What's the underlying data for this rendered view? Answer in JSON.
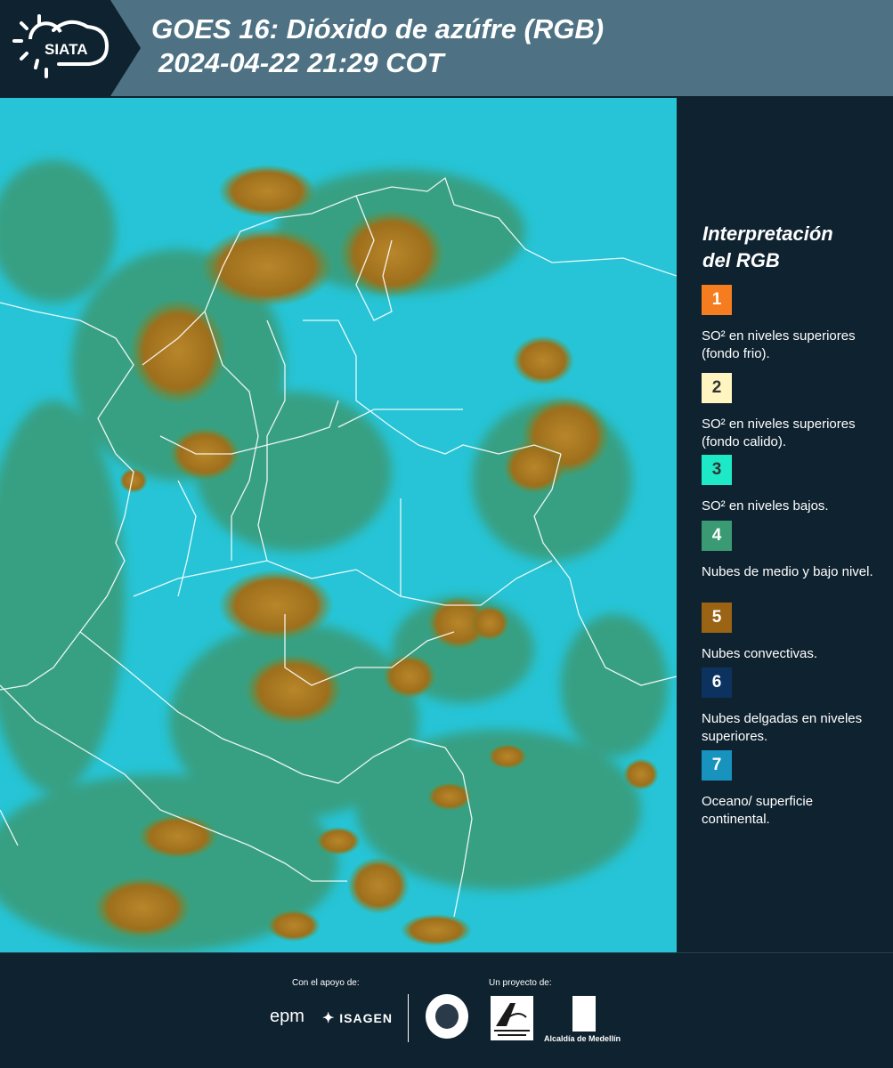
{
  "header": {
    "logo_text": "SIATA",
    "title_line1": "GOES 16: Dióxido de azúfre (RGB)",
    "title_line2": "2024-04-22 21:29 COT"
  },
  "legend": {
    "title_line1": "Interpretación",
    "title_line2": "del RGB",
    "items": [
      {
        "number": "1",
        "label": "SO² en niveles superiores (fondo frio).",
        "color": "#f57c1f",
        "text_color": "#ffffff"
      },
      {
        "number": "2",
        "label": "SO² en niveles superiores (fondo calido).",
        "color": "#fff5c0",
        "text_color": "#333333"
      },
      {
        "number": "3",
        "label": "SO² en niveles bajos.",
        "color": "#1de9c7",
        "text_color": "#333333"
      },
      {
        "number": "4",
        "label": "Nubes de medio y bajo nivel.",
        "color": "#3a9a74",
        "text_color": "#ffffff"
      },
      {
        "number": "5",
        "label": "Nubes convectivas.",
        "color": "#9a6414",
        "text_color": "#ffffff"
      },
      {
        "number": "6",
        "label": "Nubes delgadas en niveles superiores.",
        "color": "#0c3360",
        "text_color": "#ffffff"
      },
      {
        "number": "7",
        "label": "Oceano/ superficie continental.",
        "color": "#1793bd",
        "text_color": "#ffffff"
      }
    ]
  },
  "footer": {
    "support_label": "Con el apoyo de:",
    "project_label": "Un proyecto de:",
    "sponsor1": "epm",
    "sponsor2": "ISAGEN",
    "partner_metro": "Área Metropolitana Valle de Aburrá",
    "partner_alcaldia": "Alcaldía de Medellín"
  },
  "map": {
    "ocean_color": "#26c4d6",
    "cloud_low_color": "#3a9a74",
    "convective_color": "#a8771f",
    "border_color": "#ffffff"
  }
}
